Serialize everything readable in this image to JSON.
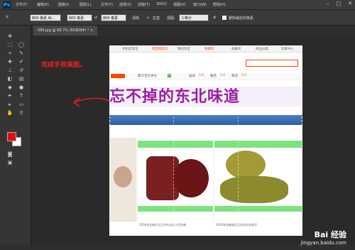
{
  "app": {
    "logo": "Ps"
  },
  "menu": [
    "文件(F)",
    "编辑(E)",
    "图像(I)",
    "图层(L)",
    "文字(Y)",
    "选择(S)",
    "滤镜(T)",
    "3D(D)",
    "视图(V)",
    "窗口(W)",
    "帮助(H)"
  ],
  "options": {
    "ratio_value": "800 像素  W...",
    "width_value": "800 像素",
    "height_value": "800 像素",
    "clear_label": "清除",
    "straighten_label": "拉直",
    "view_label": "视图:",
    "view_value": "三等分",
    "delete_cropped_label": "删除裁剪的像素"
  },
  "document": {
    "tab_label": "566.jpg @ 66.7% (RGB/8#) *"
  },
  "annotation": "完成手效果图。",
  "page": {
    "nav": [
      "手机逛淘宝",
      "淘宝网首页",
      "我的淘宝",
      "购物车",
      "收藏夹",
      "商品分类",
      "卖家中心"
    ],
    "shop_rating_label": "累计宝贝评价",
    "shop_rating_value": "0",
    "desc_label": "描述",
    "desc_value": "5.0",
    "service_label": "服务",
    "service_value": "5.0",
    "logistics_label": "物流",
    "logistics_value": "5.0",
    "banner_text": "忘不掉的东北味道",
    "product_captions": [
      "2016年北新红豆正宗东北红小豆包邮",
      "2016年北新绿豆正宗东北毛绿豆"
    ]
  },
  "watermark": {
    "brand": "Bai 经验",
    "url": "jingyan.baidu.com"
  },
  "colors": {
    "foreground": "#e01010",
    "background": "#ffffff",
    "accent": "#31a8ff",
    "annotation": "#e22222"
  }
}
